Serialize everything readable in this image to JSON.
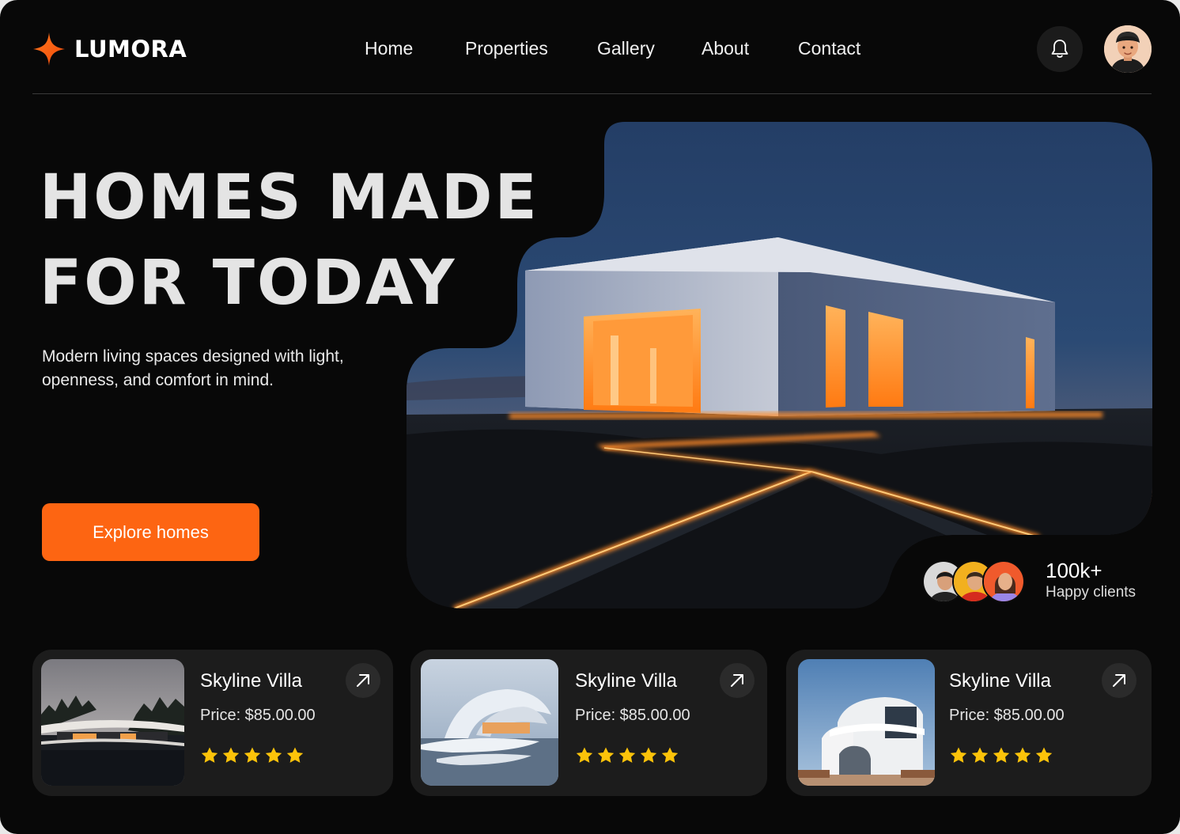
{
  "brand": {
    "name": "LUMORA",
    "accent": "#fd6512"
  },
  "nav": {
    "items": [
      {
        "label": "Home"
      },
      {
        "label": "Properties"
      },
      {
        "label": "Gallery"
      },
      {
        "label": "About"
      },
      {
        "label": "Contact"
      }
    ]
  },
  "header": {
    "notification_icon": "bell-icon",
    "avatar_icon": "user-avatar"
  },
  "hero": {
    "title_line1": "HOMES MADE",
    "title_line2": "FOR TODAY",
    "subtitle": "Modern living spaces designed with light, openness, and comfort in mind.",
    "cta_label": "Explore homes"
  },
  "clients": {
    "count": "100k+",
    "label": "Happy clients"
  },
  "cards": [
    {
      "title": "Skyline Villa",
      "price": "Price: $85.00.00",
      "rating": 5
    },
    {
      "title": "Skyline Villa",
      "price": "Price: $85.00.00",
      "rating": 5
    },
    {
      "title": "Skyline Villa",
      "price": "Price: $85.00.00",
      "rating": 5
    }
  ]
}
